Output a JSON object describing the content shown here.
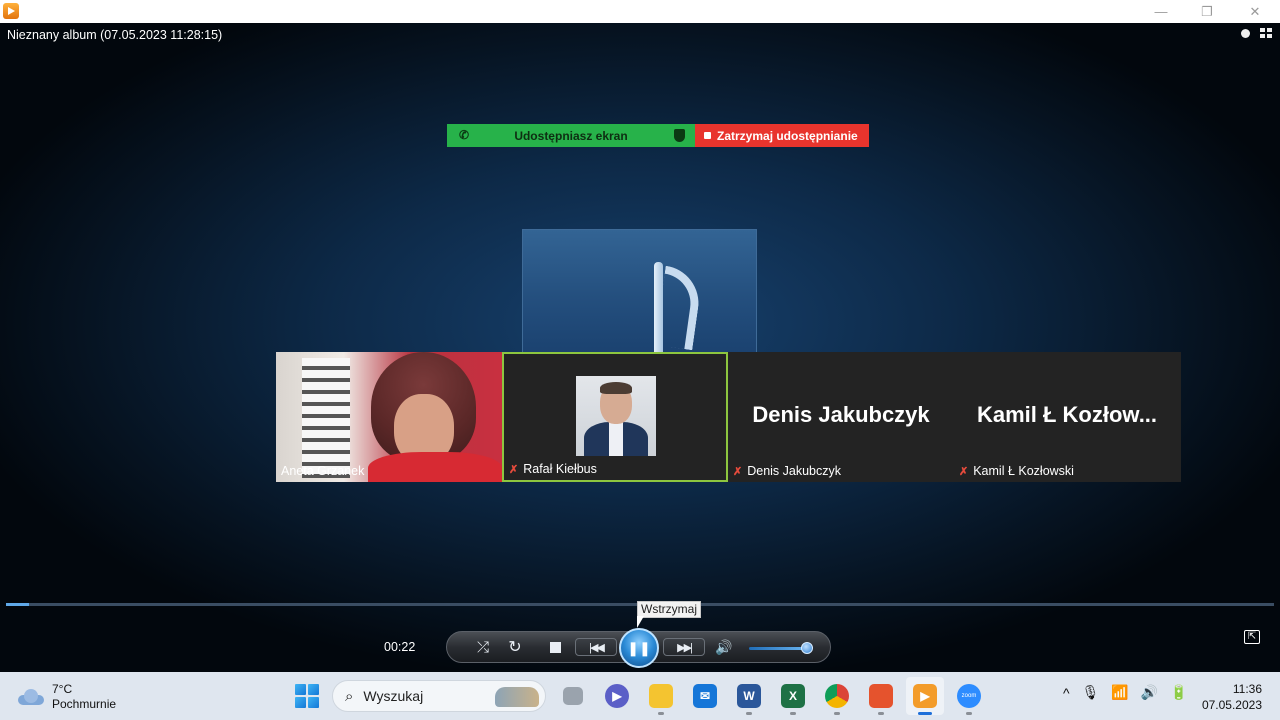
{
  "window": {
    "minimize_glyph": "—",
    "maximize_glyph": "❐",
    "close_glyph": "✕"
  },
  "player": {
    "album_title": "Nieznany album (07.05.2023 11:28:15)",
    "elapsed": "00:22",
    "progress_fraction": 0.018,
    "volume_fraction": 0.95,
    "tooltip": "Wstrzymaj"
  },
  "share_banner": {
    "sharing_label": "Udostępniasz ekran",
    "stop_label": "Zatrzymaj udostępnianie",
    "colors": {
      "green": "#27b24a",
      "red": "#e8342d"
    }
  },
  "participants": [
    {
      "name": "Aneta Grzanek",
      "video": true,
      "muted": false
    },
    {
      "name": "Rafał Kiełbus",
      "video": false,
      "photo": true,
      "muted": true,
      "speaking": true
    },
    {
      "name": "Denis Jakubczyk",
      "display_name": "Denis Jakubczyk",
      "muted": true
    },
    {
      "name": "Kamil Ł Kozłowski",
      "display_name": "Kamil Ł  Kozłow...",
      "muted": true
    }
  ],
  "controls": {
    "shuffle_glyph": "⤮",
    "repeat_glyph": "↻",
    "prev_glyph": "|◀◀",
    "play_glyph": "❚❚",
    "next_glyph": "▶▶|",
    "volume_glyph": "🔊",
    "fullscreen_glyph": "⇱"
  },
  "taskbar": {
    "weather": {
      "temp": "7°C",
      "condition": "Pochmurnie"
    },
    "search_label": "Wyszukaj",
    "apps": [
      {
        "name": "windows-start",
        "icon": "windows-logo"
      },
      {
        "name": "task-view",
        "icon": "task-view-icon"
      },
      {
        "name": "teams",
        "icon": "teams-icon",
        "color": "#5b5fc7"
      },
      {
        "name": "file-explorer",
        "icon": "folder-icon",
        "color": "#f4c430"
      },
      {
        "name": "mail",
        "icon": "mail-icon",
        "color": "#1576d8"
      },
      {
        "name": "word",
        "icon": "word-icon",
        "color": "#2b579a",
        "letter": "W"
      },
      {
        "name": "excel",
        "icon": "excel-icon",
        "color": "#1e7145",
        "letter": "X"
      },
      {
        "name": "chrome",
        "icon": "chrome-icon"
      },
      {
        "name": "powerpoint-app",
        "icon": "app-icon",
        "color": "#e5532d"
      },
      {
        "name": "media-player",
        "icon": "media-player-icon",
        "color": "#f39c2a",
        "active": true
      },
      {
        "name": "zoom",
        "icon": "zoom-icon",
        "color": "#2d8cff",
        "letter": "zoom"
      }
    ],
    "tray": {
      "chevron": "^",
      "mic": "🎙",
      "wifi": "📶",
      "volume": "🔊",
      "battery": "🔋"
    },
    "clock": {
      "time": "11:36",
      "date": "07.05.2023"
    }
  }
}
